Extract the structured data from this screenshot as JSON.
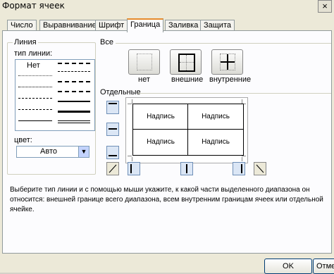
{
  "window": {
    "title": "Формат ячеек",
    "close_symbol": "×"
  },
  "tabs": [
    {
      "label": "Число"
    },
    {
      "label": "Выравнивание"
    },
    {
      "label": "Шрифт"
    },
    {
      "label": "Граница",
      "active": true
    },
    {
      "label": "Заливка"
    },
    {
      "label": "Защита"
    }
  ],
  "line_group": {
    "title": "Линия",
    "type_label": "тип линии:",
    "none_label": "Нет",
    "color_label": "цвет:",
    "color_value": "Авто"
  },
  "presets": {
    "title": "Все",
    "buttons": [
      {
        "label": "нет",
        "icon": "border-none-icon"
      },
      {
        "label": "внешние",
        "icon": "border-outline-icon"
      },
      {
        "label": "внутренние",
        "icon": "border-inside-icon"
      }
    ]
  },
  "borders": {
    "title": "Отдельные",
    "preview_cells": [
      "Надпись",
      "Надпись",
      "Надпись",
      "Надпись"
    ]
  },
  "description": "Выберите тип линии и с помощью мыши укажите, к какой части выделенного диапазона он относится: внешней границе всего диапазона, всем внутренним границам ячеек или отдельной ячейке.",
  "footer": {
    "ok_label": "OK",
    "cancel_label": "Отмена"
  },
  "colors": {
    "accent_tab": "#e68b2c",
    "border_blue": "#7f9db9"
  }
}
